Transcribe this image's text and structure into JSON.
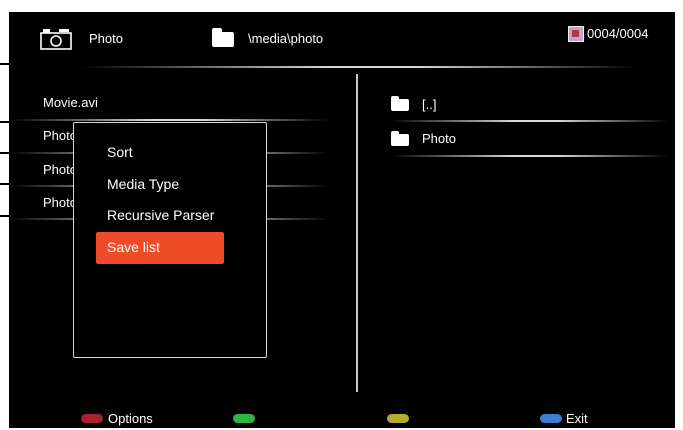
{
  "header": {
    "source_label": "Photo",
    "path": "\\media\\photo",
    "counter": "0004/0004"
  },
  "file_list": [
    "Movie.avi",
    "Photo",
    "Photo",
    "Photo"
  ],
  "folder_list": [
    "[..]",
    "Photo"
  ],
  "popup_menu": {
    "items": [
      "Sort",
      "Media Type",
      "Recursive Parser"
    ],
    "selected": "Save list"
  },
  "footer": {
    "red_label": "Options",
    "blue_label": "Exit",
    "colors": {
      "red": "#a8232f",
      "green": "#2fb541",
      "yellow": "#b4ad2f",
      "blue": "#3b7fd0"
    }
  },
  "colors": {
    "accent": "#ee4b26",
    "background": "#000000"
  }
}
